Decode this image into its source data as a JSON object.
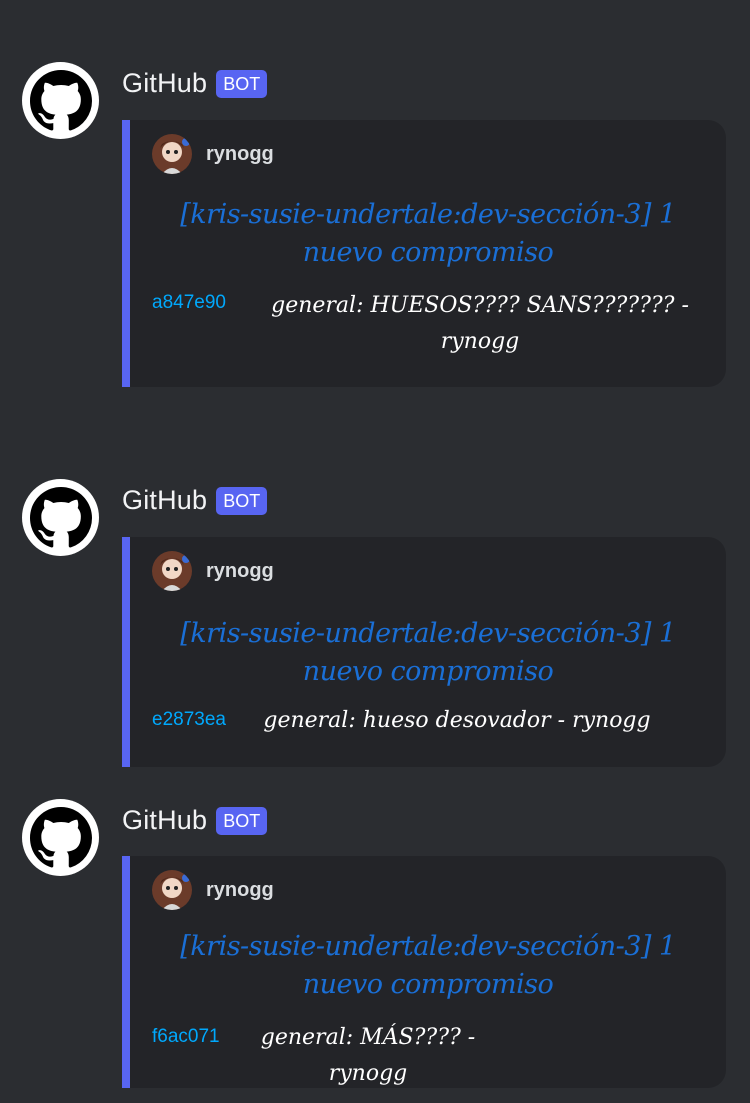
{
  "messages": [
    {
      "author": "GitHub",
      "badge": "BOT",
      "embed": {
        "author": "rynogg",
        "title": "[kris-susie-undertale:dev-sección-3] 1 nuevo compromiso",
        "commit_hash": "a847e90",
        "commit_message": "general: HUESOS???? SANS??????? - rynogg"
      }
    },
    {
      "author": "GitHub",
      "badge": "BOT",
      "embed": {
        "author": "rynogg",
        "title": "[kris-susie-undertale:dev-sección-3] 1 nuevo compromiso",
        "commit_hash": "e2873ea",
        "commit_message": "general: hueso desovador - rynogg"
      }
    },
    {
      "author": "GitHub",
      "badge": "BOT",
      "embed": {
        "author": "rynogg",
        "title": "[kris-susie-undertale:dev-sección-3] 1 nuevo compromiso",
        "commit_hash": "f6ac071",
        "commit_message": "general: MÁS???? - rynogg"
      }
    }
  ],
  "colors": {
    "background": "#2b2d31",
    "embed_background": "#232428",
    "embed_accent": "#5865f2",
    "bot_badge": "#5865f2",
    "commit_hash": "#00a8fc",
    "embed_title": "#1a6fd6"
  },
  "icons": {
    "bot_avatar": "github-octocat-icon",
    "embed_author_avatar": "user-avatar-icon"
  }
}
